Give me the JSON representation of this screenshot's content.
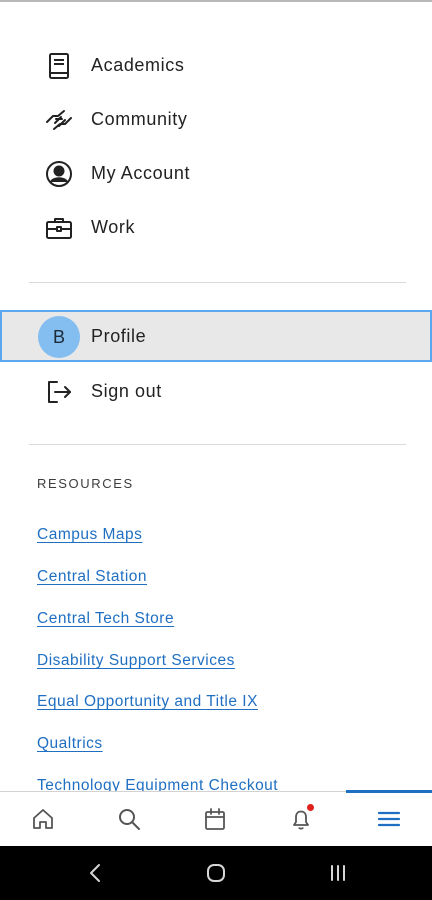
{
  "menu": {
    "items": [
      {
        "label": "Academics",
        "icon": "book-icon"
      },
      {
        "label": "Community",
        "icon": "handshake-icon"
      },
      {
        "label": "My Account",
        "icon": "account-circle-icon"
      },
      {
        "label": "Work",
        "icon": "briefcase-icon"
      }
    ]
  },
  "profile": {
    "initial": "B",
    "label": "Profile"
  },
  "signout": {
    "label": "Sign out",
    "icon": "sign-out-icon"
  },
  "resources": {
    "title": "RESOURCES",
    "links": [
      "Campus Maps",
      "Central Station",
      "Central Tech Store",
      "Disability Support Services",
      "Equal Opportunity and Title IX",
      "Qualtrics",
      "Technology Equipment Checkout"
    ]
  },
  "tabbar": {
    "tabs": [
      {
        "name": "home",
        "icon": "home-icon"
      },
      {
        "name": "search",
        "icon": "search-icon"
      },
      {
        "name": "calendar",
        "icon": "calendar-icon"
      },
      {
        "name": "notifications",
        "icon": "bell-icon",
        "has_badge": true
      },
      {
        "name": "menu",
        "icon": "hamburger-menu-icon",
        "active": true
      }
    ]
  },
  "colors": {
    "link": "#1f6fc2",
    "active_tab": "#1f6fc2",
    "profile_highlight": "#e8e8e8",
    "profile_border": "#5aa8ee",
    "avatar": "#84bdf0",
    "badge": "#e0201b"
  }
}
